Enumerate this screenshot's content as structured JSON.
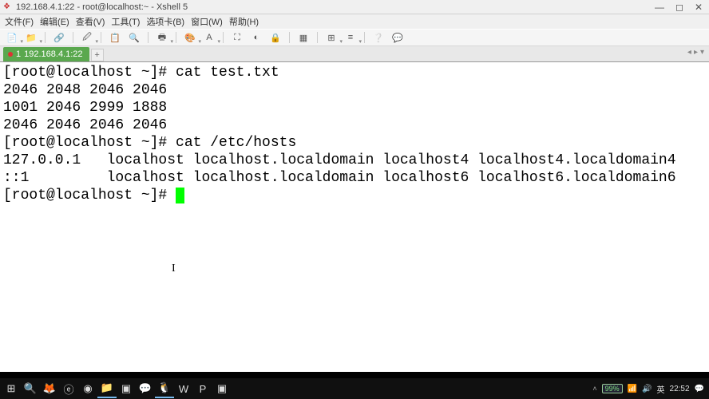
{
  "window": {
    "title": "192.168.4.1:22 - root@localhost:~ - Xshell 5"
  },
  "menu": {
    "file": "文件(F)",
    "edit": "编辑(E)",
    "view": "查看(V)",
    "tools": "工具(T)",
    "tabs": "选项卡(B)",
    "window": "窗口(W)",
    "help": "帮助(H)"
  },
  "tabs": {
    "active_index": "1",
    "active_label": "192.168.4.1:22",
    "add": "+"
  },
  "terminal": {
    "lines": [
      "[root@localhost ~]# cat test.txt",
      "2046 2048 2046 2046",
      "1001 2046 2999 1888",
      "2046 2046 2046 2046",
      "[root@localhost ~]# cat /etc/hosts",
      "127.0.0.1   localhost localhost.localdomain localhost4 localhost4.localdomain4",
      "::1         localhost localhost.localdomain localhost6 localhost6.localdomain6",
      "[root@localhost ~]# "
    ]
  },
  "tray": {
    "battery": "99%",
    "ime": "英",
    "time": "22:52"
  }
}
